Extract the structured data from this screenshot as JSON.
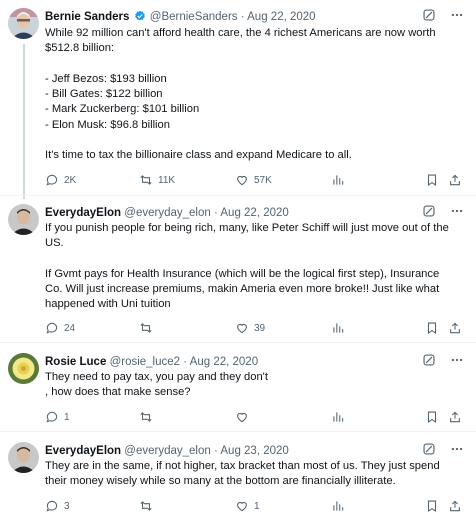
{
  "tweets": [
    {
      "name": "Bernie Sanders",
      "handle": "@BernieSanders",
      "sep": "·",
      "date": "Aug 22, 2020",
      "verified": true,
      "body": "While 92 million can't afford health care, the 4 richest Americans are now worth\n$512.8 billion:\n\n- Jeff Bezos: $193 billion\n- Bill Gates: $122 billion\n- Mark Zuckerberg: $101 billion\n- Elon Musk: $96.8 billion\n\nIt's time to tax the billionaire class and expand Medicare to all.",
      "replies": "2K",
      "reposts": "11K",
      "likes": "57K",
      "views": ""
    },
    {
      "name": "EverydayElon",
      "handle": "@everyday_elon",
      "sep": "·",
      "date": "Aug 22, 2020",
      "body": "If you punish people for being rich, many, like Peter Schiff will just move out of the\nUS.\n\nIf Gvmt pays for Health Insurance (which will be the logical first step), Insurance\nCo. Will just increase premiums, makin Ameria even more broke!! Just like what\nhappened with Uni tuition",
      "replies": "24",
      "reposts": "",
      "likes": "39",
      "views": ""
    },
    {
      "name": "Rosie Luce",
      "handle": "@rosie_luce2",
      "sep": "·",
      "date": "Aug 22, 2020",
      "body": "They need to pay tax, you pay and they don't\n, how does that make sense?",
      "replies": "1",
      "reposts": "",
      "likes": "",
      "views": ""
    },
    {
      "name": "EverydayElon",
      "handle": "@everyday_elon",
      "sep": "·",
      "date": "Aug 23, 2020",
      "body": "They are in the same, if not higher, tax bracket than most of us. They just spend\ntheir money wisely while so many at the bottom are financially illiterate.",
      "replies": "3",
      "reposts": "",
      "likes": "1",
      "views": ""
    }
  ],
  "icons": {
    "verified": "verified-badge-icon",
    "grok": "grok-icon",
    "more": "more-icon",
    "reply": "reply-icon",
    "repost": "repost-icon",
    "like": "like-icon",
    "views": "views-icon",
    "bookmark": "bookmark-icon",
    "share": "share-icon"
  },
  "colors": {
    "text": "#0f1419",
    "secondary": "#536471",
    "verified": "#1d9bf0",
    "divider": "#eff3f4"
  }
}
